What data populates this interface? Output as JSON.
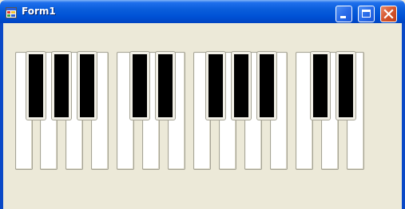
{
  "window": {
    "title": "Form1"
  },
  "titlebar_buttons": {
    "minimize": "minimize-icon",
    "maximize": "maximize-icon",
    "close": "close-icon"
  },
  "piano": {
    "white_key_count": 14,
    "black_key_count": 10,
    "colors": {
      "white_key": "#FFFFFF",
      "black_key": "#000000",
      "form_background": "#ECE9D8",
      "titlebar": "#0052D6"
    }
  }
}
